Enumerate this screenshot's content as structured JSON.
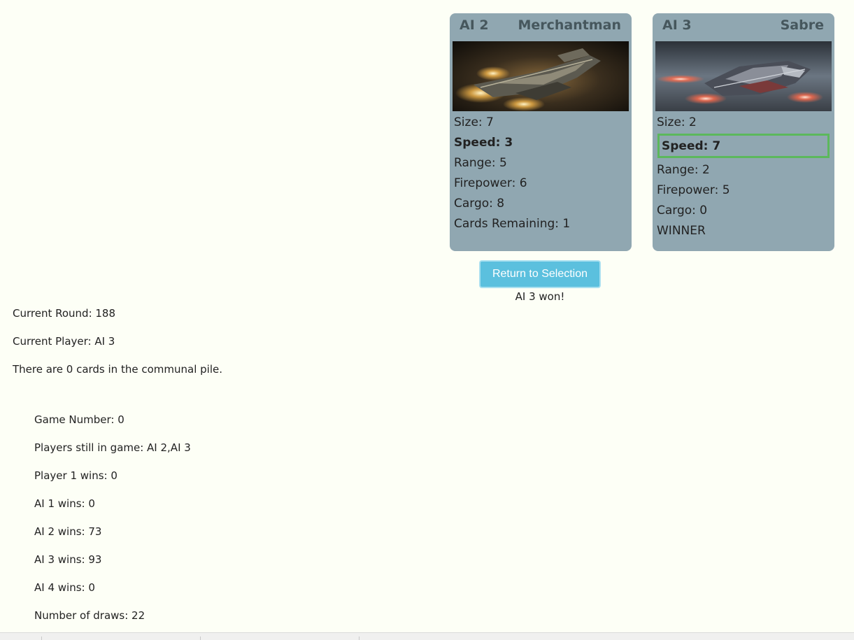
{
  "cards": [
    {
      "owner": "AI 2",
      "ship": "Merchantman",
      "image_icon": "merchantman-ship-image",
      "stats": {
        "size": "Size: 7",
        "speed": "Speed: 3",
        "range": "Range: 5",
        "firepower": "Firepower: 6",
        "cargo": "Cargo: 8"
      },
      "footer": "Cards Remaining: 1"
    },
    {
      "owner": "AI 3",
      "ship": "Sabre",
      "image_icon": "sabre-ship-image",
      "stats": {
        "size": "Size: 2",
        "speed": "Speed: 7",
        "range": "Range: 2",
        "firepower": "Firepower: 5",
        "cargo": "Cargo: 0"
      },
      "footer": "WINNER"
    }
  ],
  "actions": {
    "return_label": "Return to Selection",
    "result_message": "AI 3 won!"
  },
  "game_info": {
    "current_round": "Current Round: 188",
    "current_player": "Current Player: AI 3",
    "communal_pile": "There are 0 cards in the communal pile."
  },
  "game_stats": {
    "game_number": "Game Number: 0",
    "players_in_game": "Players still in game: AI 2,AI 3",
    "player1_wins": "Player 1 wins: 0",
    "ai1_wins": "AI 1 wins: 0",
    "ai2_wins": "AI 2 wins: 73",
    "ai3_wins": "AI 3 wins: 93",
    "ai4_wins": "AI 4 wins: 0",
    "draws": "Number of draws: 22"
  },
  "colors": {
    "card_background": "#90a7b1",
    "card_header_text": "#46575d",
    "highlight_border": "#5cb85c",
    "button_background": "#5bc0de",
    "page_background": "#fdfff6"
  }
}
